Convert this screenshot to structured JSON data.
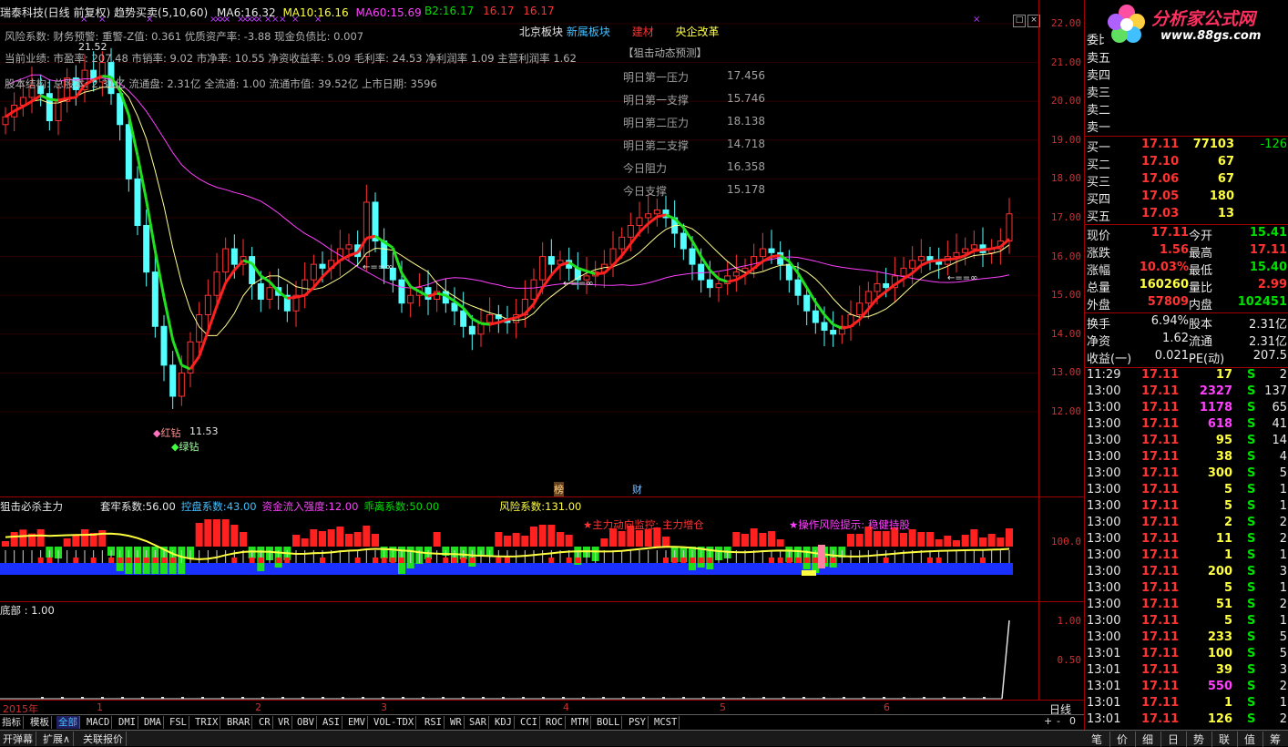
{
  "header": {
    "title": "瑞泰科技(日线 前复权)",
    "indicator_name": "趋势买卖(5,10,60)",
    "ma6_label": "MA6:",
    "ma6_value": "16.32",
    "ma10_label": "MA10:",
    "ma10_value": "16.16",
    "ma60_label": "MA60:",
    "ma60_value": "15.69",
    "b2_label": "B2:",
    "b2_value": "16.17",
    "v2": "16.17",
    "v3": "16.17"
  },
  "info_lines": [
    "风险系数: 财务预警: 重警-Z值: 0.361 优质资产率: -3.88 现金负债比: 0.007",
    "当前业绩: 市盈率: 207.48 市销率: 9.02 市净率: 10.55 净资收益率: 5.09 毛利率: 24.53 净利润率 1.09 主营利润率 1.62",
    "股本结构: 总股本: 2.31亿 流通盘: 2.31亿 全流通: 1.00 流通市值: 39.52亿 上市日期: 3596"
  ],
  "sectors": [
    "北京板块",
    "新属板块",
    "建材",
    "央企改革"
  ],
  "forecast": {
    "title": "【狙击动态预测】",
    "rows": [
      {
        "label": "明日第一压力",
        "value": "17.456"
      },
      {
        "label": "明日第一支撑",
        "value": "15.746"
      },
      {
        "label": "明日第二压力",
        "value": "18.138"
      },
      {
        "label": "明日第二支撑",
        "value": "14.718"
      },
      {
        "label": "今日阻力",
        "value": "16.358"
      },
      {
        "label": "今日支撑",
        "value": "15.178"
      }
    ]
  },
  "chart_labels": {
    "high_mark": "21.52",
    "low_mark": "11.53",
    "red_diamond": "红钻",
    "green_diamond": "绿钻",
    "arrow1": "←==∞",
    "arrow2": "←==∞",
    "arrow3": "←==∞",
    "bang": "榜",
    "cai": "财"
  },
  "main_axis": [
    "22.00",
    "21.00",
    "20.00",
    "19.00",
    "18.00",
    "17.00",
    "16.00",
    "15.00",
    "14.00",
    "13.00",
    "12.00"
  ],
  "sub1": {
    "title": "狙击必杀主力",
    "items": [
      {
        "label": "套牢系数:",
        "value": "56.00",
        "color": "#e8e8e8"
      },
      {
        "label": "控盘系数:",
        "value": "43.00",
        "color": "#40c0ff"
      },
      {
        "label": "资金流入强度:",
        "value": "12.00",
        "color": "#ff40ff"
      },
      {
        "label": "乖离系数:",
        "value": "50.00",
        "color": "#00e000"
      },
      {
        "label": "风险系数:",
        "value": "131.00",
        "color": "#ffff40"
      }
    ],
    "monitor": "★主力动向监控: 主力增仓",
    "risk_tip": "★操作风险提示: 稳健持股",
    "axis": "100.0"
  },
  "sub2": {
    "title": "底部 : 1.00",
    "axis": [
      "1.00",
      "0.50"
    ]
  },
  "timeline": [
    "2015年",
    "1",
    "2",
    "3",
    "4",
    "5",
    "6"
  ],
  "period": "日线",
  "tabs": [
    "指标",
    "模板",
    "全部",
    "MACD",
    "DMI",
    "DMA",
    "FSL",
    "TRIX",
    "BRAR",
    "CR",
    "VR",
    "OBV",
    "ASI",
    "EMV",
    "VOL-TDX",
    "RSI",
    "WR",
    "SAR",
    "KDJ",
    "CCI",
    "ROC",
    "MTM",
    "BOLL",
    "PSY",
    "MCST"
  ],
  "bottom_buttons": [
    "开弹幕",
    "扩展∧",
    "关联报价"
  ],
  "logo": {
    "text": "分析家公式网",
    "url": "www.88gs.com"
  },
  "orderbook": {
    "committee": "委比",
    "sells": [
      "卖五",
      "卖四",
      "卖三",
      "卖二",
      "卖一"
    ],
    "buys": [
      {
        "label": "买一",
        "price": "17.11",
        "vol": "77103",
        "chg": "-126"
      },
      {
        "label": "买二",
        "price": "17.10",
        "vol": "67",
        "chg": ""
      },
      {
        "label": "买三",
        "price": "17.06",
        "vol": "67",
        "chg": ""
      },
      {
        "label": "买四",
        "price": "17.05",
        "vol": "180",
        "chg": ""
      },
      {
        "label": "买五",
        "price": "17.03",
        "vol": "13",
        "chg": ""
      }
    ]
  },
  "quote": [
    {
      "l1": "现价",
      "v1": "17.11",
      "c1": "red",
      "l2": "今开",
      "v2": "15.41",
      "c2": "grn"
    },
    {
      "l1": "涨跌",
      "v1": "1.56",
      "c1": "red",
      "l2": "最高",
      "v2": "17.11",
      "c2": "red"
    },
    {
      "l1": "涨幅",
      "v1": "10.03%",
      "c1": "red",
      "l2": "最低",
      "v2": "15.40",
      "c2": "grn"
    },
    {
      "l1": "总量",
      "v1": "160260",
      "c1": "yel",
      "l2": "量比",
      "v2": "2.99",
      "c2": "red"
    },
    {
      "l1": "外盘",
      "v1": "57809",
      "c1": "red",
      "l2": "内盘",
      "v2": "102451",
      "c2": "grn"
    }
  ],
  "fund": [
    {
      "l1": "换手",
      "v1": "6.94%",
      "l2": "股本",
      "v2": "2.31亿"
    },
    {
      "l1": "净资",
      "v1": "1.62",
      "l2": "流通",
      "v2": "2.31亿"
    },
    {
      "l1": "收益(一)",
      "v1": "0.021",
      "l2": "PE(动)",
      "v2": "207.5"
    }
  ],
  "ticks": [
    {
      "t": "11:29",
      "p": "17.11",
      "v": "17",
      "vc": "yel",
      "s": "S",
      "n": "2"
    },
    {
      "t": "13:00",
      "p": "17.11",
      "v": "2327",
      "vc": "mag",
      "s": "S",
      "n": "137"
    },
    {
      "t": "13:00",
      "p": "17.11",
      "v": "1178",
      "vc": "mag",
      "s": "S",
      "n": "65"
    },
    {
      "t": "13:00",
      "p": "17.11",
      "v": "618",
      "vc": "mag",
      "s": "S",
      "n": "41"
    },
    {
      "t": "13:00",
      "p": "17.11",
      "v": "95",
      "vc": "yel",
      "s": "S",
      "n": "14"
    },
    {
      "t": "13:00",
      "p": "17.11",
      "v": "38",
      "vc": "yel",
      "s": "S",
      "n": "4"
    },
    {
      "t": "13:00",
      "p": "17.11",
      "v": "300",
      "vc": "yel",
      "s": "S",
      "n": "5"
    },
    {
      "t": "13:00",
      "p": "17.11",
      "v": "5",
      "vc": "yel",
      "s": "S",
      "n": "1"
    },
    {
      "t": "13:00",
      "p": "17.11",
      "v": "5",
      "vc": "yel",
      "s": "S",
      "n": "1"
    },
    {
      "t": "13:00",
      "p": "17.11",
      "v": "2",
      "vc": "yel",
      "s": "S",
      "n": "2"
    },
    {
      "t": "13:00",
      "p": "17.11",
      "v": "11",
      "vc": "yel",
      "s": "S",
      "n": "2"
    },
    {
      "t": "13:00",
      "p": "17.11",
      "v": "1",
      "vc": "yel",
      "s": "S",
      "n": "1"
    },
    {
      "t": "13:00",
      "p": "17.11",
      "v": "200",
      "vc": "yel",
      "s": "S",
      "n": "3"
    },
    {
      "t": "13:00",
      "p": "17.11",
      "v": "5",
      "vc": "yel",
      "s": "S",
      "n": "1"
    },
    {
      "t": "13:00",
      "p": "17.11",
      "v": "51",
      "vc": "yel",
      "s": "S",
      "n": "2"
    },
    {
      "t": "13:00",
      "p": "17.11",
      "v": "5",
      "vc": "yel",
      "s": "S",
      "n": "1"
    },
    {
      "t": "13:00",
      "p": "17.11",
      "v": "233",
      "vc": "yel",
      "s": "S",
      "n": "5"
    },
    {
      "t": "13:01",
      "p": "17.11",
      "v": "100",
      "vc": "yel",
      "s": "S",
      "n": "5"
    },
    {
      "t": "13:01",
      "p": "17.11",
      "v": "39",
      "vc": "yel",
      "s": "S",
      "n": "3"
    },
    {
      "t": "13:01",
      "p": "17.11",
      "v": "550",
      "vc": "mag",
      "s": "S",
      "n": "2"
    },
    {
      "t": "13:01",
      "p": "17.11",
      "v": "1",
      "vc": "yel",
      "s": "S",
      "n": "1"
    },
    {
      "t": "13:01",
      "p": "17.11",
      "v": "126",
      "vc": "yel",
      "s": "S",
      "n": "2"
    }
  ],
  "right_tabs": [
    "笔",
    "价",
    "细",
    "日",
    "势",
    "联",
    "值",
    "筹"
  ],
  "candles": [
    19.6,
    19.9,
    20.1,
    20.4,
    20.2,
    19.5,
    20.0,
    20.6,
    20.3,
    20.8,
    20.5,
    21.0,
    20.2,
    19.4,
    18.0,
    16.8,
    15.6,
    14.2,
    13.2,
    12.4,
    13.0,
    13.8,
    14.5,
    15.0,
    15.6,
    16.2,
    15.8,
    16.0,
    15.3,
    14.9,
    15.2,
    15.0,
    14.6,
    15.0,
    15.4,
    15.8,
    15.7,
    15.9,
    16.2,
    16.3,
    16.0,
    17.4,
    16.4,
    15.7,
    15.4,
    14.8,
    15.0,
    15.2,
    14.9,
    15.1,
    14.8,
    14.6,
    14.2,
    14.0,
    14.3,
    14.5,
    14.4,
    14.3,
    14.5,
    14.9,
    15.4,
    16.0,
    15.8,
    15.9,
    15.7,
    15.4,
    15.5,
    15.6,
    15.8,
    16.2,
    16.5,
    16.8,
    17.0,
    17.1,
    17.2,
    17.0,
    16.6,
    16.2,
    15.8,
    15.4,
    15.2,
    15.3,
    15.5,
    15.6,
    15.7,
    16.0,
    16.2,
    16.1,
    15.8,
    15.4,
    15.0,
    14.6,
    14.3,
    14.1,
    14.0,
    14.2,
    14.5,
    14.8,
    15.1,
    15.3,
    15.2,
    15.5,
    15.7,
    15.9,
    16.0,
    15.9,
    15.8,
    16.0,
    16.1,
    16.2,
    16.3,
    16.1,
    16.2,
    16.4,
    17.1
  ]
}
